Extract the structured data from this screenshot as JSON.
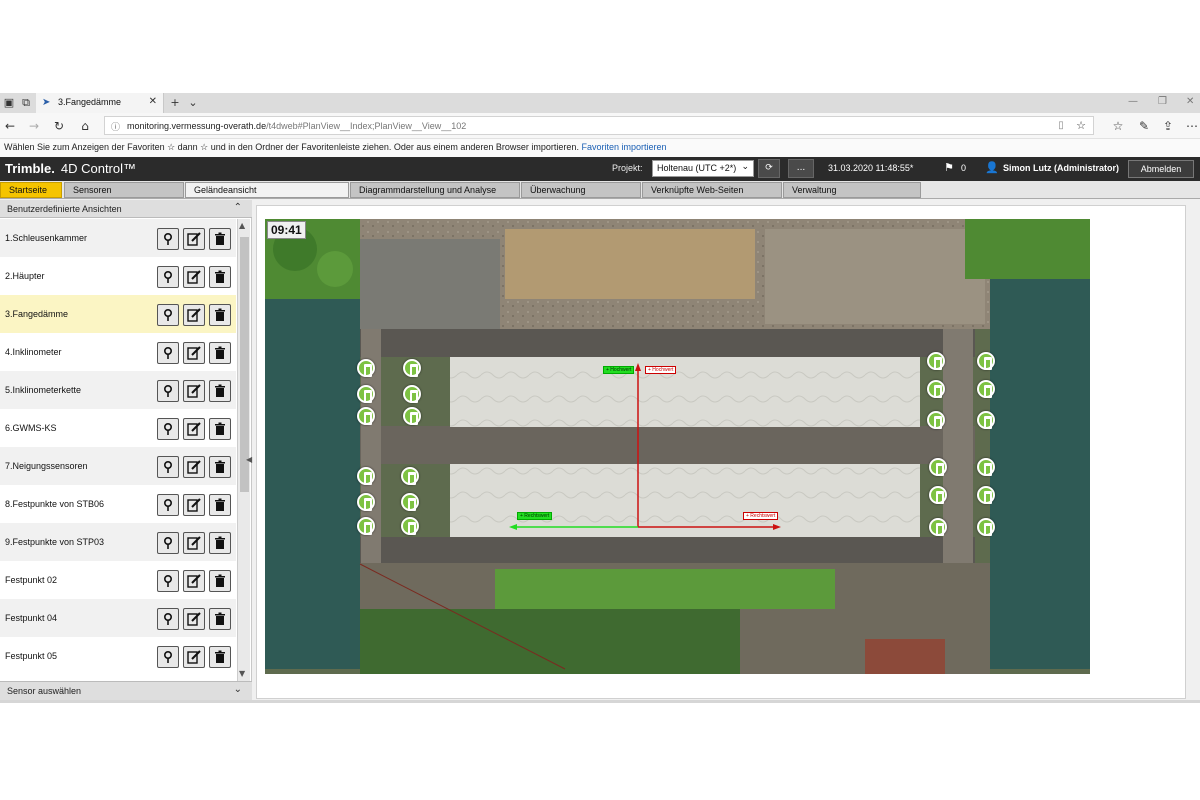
{
  "browser": {
    "tab_title": "3.Fangedämme",
    "url_host": "monitoring.vermessung-overath.de",
    "url_path": "/t4dweb#PlanView__Index;PlanView__View__102",
    "favorites_text": "Wählen Sie zum Anzeigen der Favoriten ☆ dann ☆ und in den Ordner der Favoritenleiste ziehen. Oder aus einem anderen Browser importieren.",
    "favorites_link": "Favoriten importieren"
  },
  "app": {
    "brand": "Trimble.",
    "product": "4D Control™",
    "project_label": "Projekt:",
    "project_value": "Holtenau (UTC +2*)",
    "refresh_label": "⟳",
    "more_label": "...",
    "datetime": "31.03.2020 11:48:55*",
    "flag_count": "0",
    "user": "Simon Lutz (Administrator)",
    "logout": "Abmelden"
  },
  "nav": {
    "tabs": [
      "Startseite",
      "Sensoren",
      "Geländeansicht",
      "Diagrammdarstellung und Analyse",
      "Überwachung",
      "Verknüpfte Web-Seiten",
      "Verwaltung"
    ]
  },
  "sidebar": {
    "header": "Benutzerdefinierte Ansichten",
    "footer": "Sensor auswählen",
    "items": [
      "1.Schleusenkammer",
      "2.Häupter",
      "3.Fangedämme",
      "4.Inklinometer",
      "5.Inklinometerkette",
      "6.GWMS-KS",
      "7.Neigungssensoren",
      "8.Festpunkte von STB06",
      "9.Festpunkte von STP03",
      "Festpunkt 02",
      "Festpunkt 04",
      "Festpunkt 05"
    ]
  },
  "map": {
    "time": "09:41",
    "axis_labels": {
      "top_green": "+ Hochwert",
      "top_red": "+ Hochwert",
      "bottom_green": "+ Rechtswert",
      "bottom_red": "+ Rechtswert"
    },
    "colors": {
      "sensor": "#7dc242",
      "water": "#2f5a55",
      "grass": "#4f8a33",
      "cover": "#dcdcd6",
      "axis_red": "#cc1111",
      "axis_green": "#22dd22"
    }
  }
}
